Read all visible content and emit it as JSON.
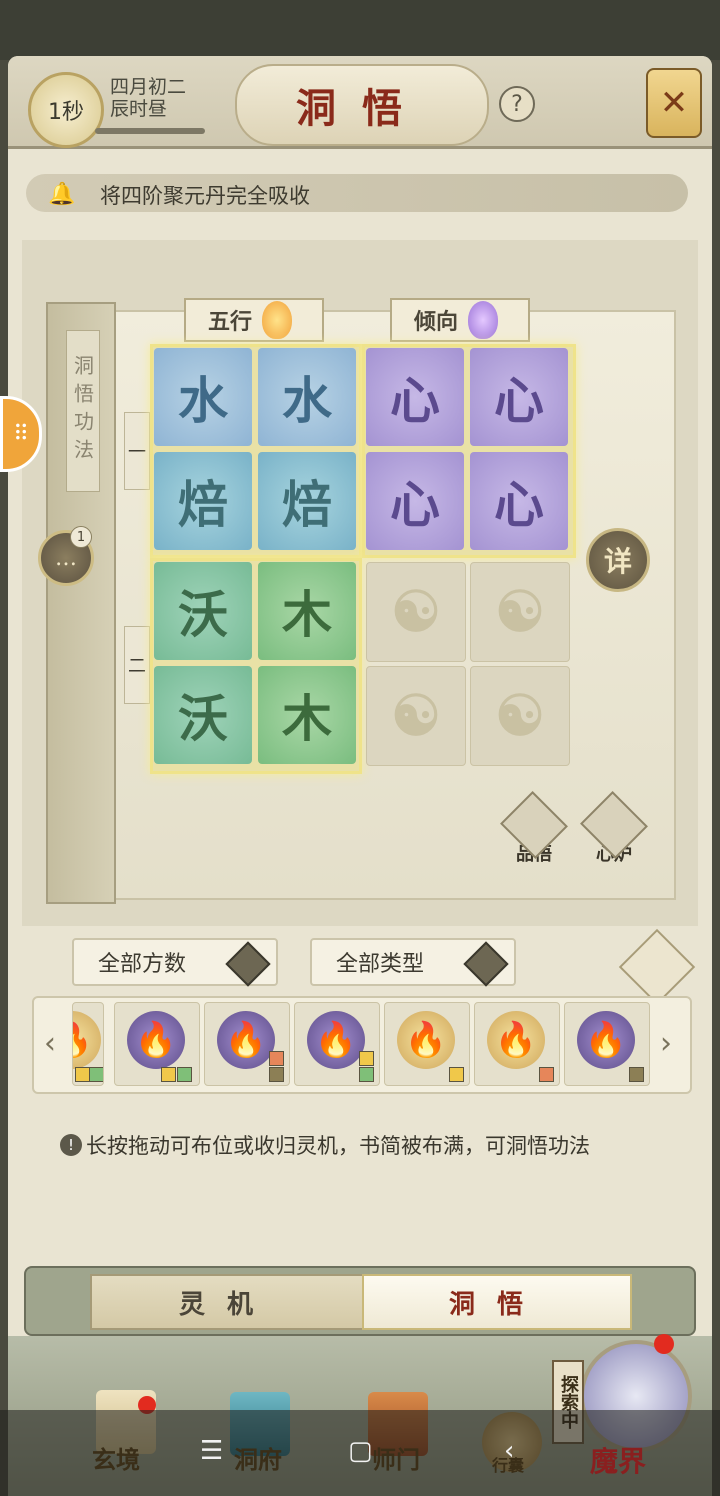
{
  "header": {
    "timer": "1秒",
    "date_line1": "四月初二",
    "date_line2": "辰时昼",
    "title": "洞悟",
    "help": "?"
  },
  "notice": {
    "text": "将四阶聚元丹完全吸收"
  },
  "book": {
    "spine_label": "洞悟功法",
    "tab_wuxing": "五行",
    "tab_qingxiang": "倾向",
    "row_one": "一",
    "row_two": "二",
    "detail_button": "详",
    "pinwu_label": "品悟",
    "xinlu_label": "心炉",
    "grid": {
      "r1c1": "水",
      "r1c2": "水",
      "r1c3": "心",
      "r1c4": "心",
      "r2c1": "焙",
      "r2c2": "焙",
      "r2c3": "心",
      "r2c4": "心",
      "r3c1": "沃",
      "r3c2": "木",
      "r4c1": "沃",
      "r4c2": "木"
    }
  },
  "chat": {
    "badge": "1"
  },
  "filters": {
    "all_count": "全部方数",
    "all_type": "全部类型"
  },
  "strip_arrows": {
    "left": "‹",
    "right": "›"
  },
  "hint": {
    "icon": "!",
    "text": "长按拖动可布位或收归灵机，书简被布满，可洞悟功法"
  },
  "tabs": {
    "lingji": "灵机",
    "dongwu": "洞悟"
  },
  "nav": {
    "xuanjing": "玄境",
    "dongfu": "洞府",
    "shimen": "师门",
    "xingnang": "行囊",
    "mojie": "魔界",
    "explore": "探索中"
  },
  "colors": {
    "title_red": "#8a2a1a",
    "water_blue": "#8fb4d4",
    "heart_purple": "#a493d2",
    "wood_green": "#7abd7f",
    "glow_gold": "#efe38a"
  }
}
